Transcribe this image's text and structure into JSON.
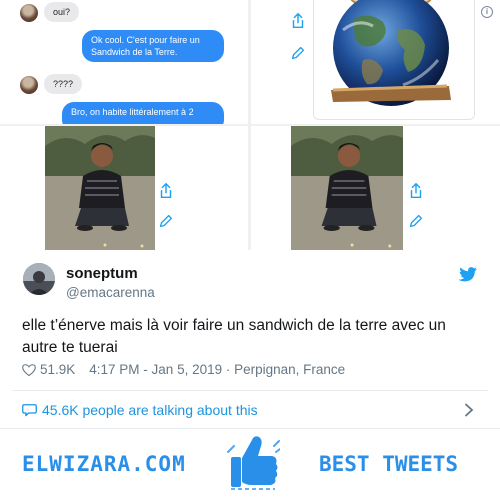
{
  "chat": {
    "msg1": "oui?",
    "msg2": "Ok cool. C'est pour faire un Sandwich de la Terre.",
    "msg3": "????",
    "msg4": "Bro, on habite littéralement à 2"
  },
  "tweet": {
    "display_name": "soneptum",
    "handle": "@emacarenna",
    "text": "elle t’énerve mais là voir faire un sandwich de la terre avec un autre te tuerai",
    "likes": "51.9K",
    "time": "4:17 PM - Jan 5, 2019 · Perpignan, France",
    "talking": "45.6K people are talking about this"
  },
  "banner": {
    "site": "ELWIZARA.COM",
    "tagline": "BEST TWEETS"
  },
  "colors": {
    "twitter_blue": "#1da1f2",
    "imessage_blue": "#2f8cf7",
    "banner_blue": "#2a8fe8"
  },
  "icons": [
    "share-icon",
    "edit-icon",
    "info-icon",
    "twitter-bird-icon",
    "heart-icon",
    "speech-bubble-icon",
    "chevron-right-icon",
    "thumbs-up-icon"
  ]
}
